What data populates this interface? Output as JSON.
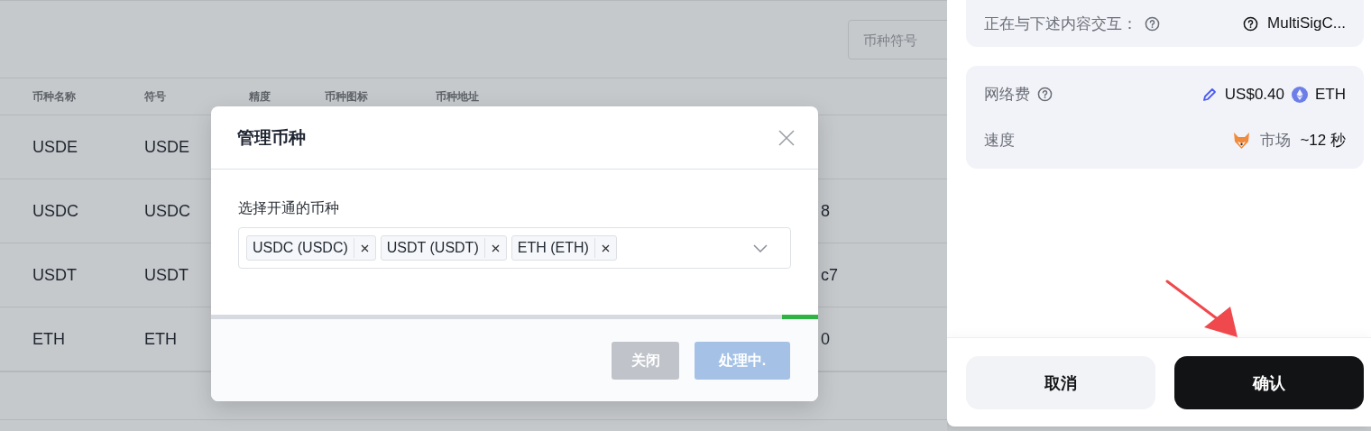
{
  "page": {
    "search": {
      "placeholder": "币种符号"
    },
    "table": {
      "columns": [
        "币种名称",
        "符号",
        "精度",
        "币种图标",
        "币种地址"
      ],
      "rows": [
        {
          "name": "USDE",
          "symbol": "USDE"
        },
        {
          "name": "USDC",
          "symbol": "USDC",
          "address": "8"
        },
        {
          "name": "USDT",
          "symbol": "USDT",
          "address": "c7"
        },
        {
          "name": "ETH",
          "symbol": "ETH",
          "address": "0"
        }
      ]
    }
  },
  "modal": {
    "title": "管理币种",
    "progress": {
      "level": 0.06
    },
    "field_label": "选择开通的币种",
    "selected_tokens": [
      "USDC (USDC)",
      "USDT (USDT)",
      "ETH (ETH)"
    ],
    "buttons": [
      {
        "label": "关闭",
        "kind": "secondary",
        "disabled": true
      },
      {
        "label": "处理中.",
        "kind": "primary",
        "disabled": true
      }
    ]
  },
  "wallet": {
    "interaction": {
      "label": "正在与下述内容交互：",
      "value": "MultiSigC..."
    },
    "fee": {
      "label": "网络费",
      "amount": "US$0.40",
      "token": "ETH"
    },
    "speed": {
      "label": "速度",
      "mode": "市场",
      "time": "~12 秒"
    },
    "buttons": [
      {
        "label": "取消",
        "kind": "secondary"
      },
      {
        "label": "确认",
        "kind": "primary"
      }
    ]
  }
}
